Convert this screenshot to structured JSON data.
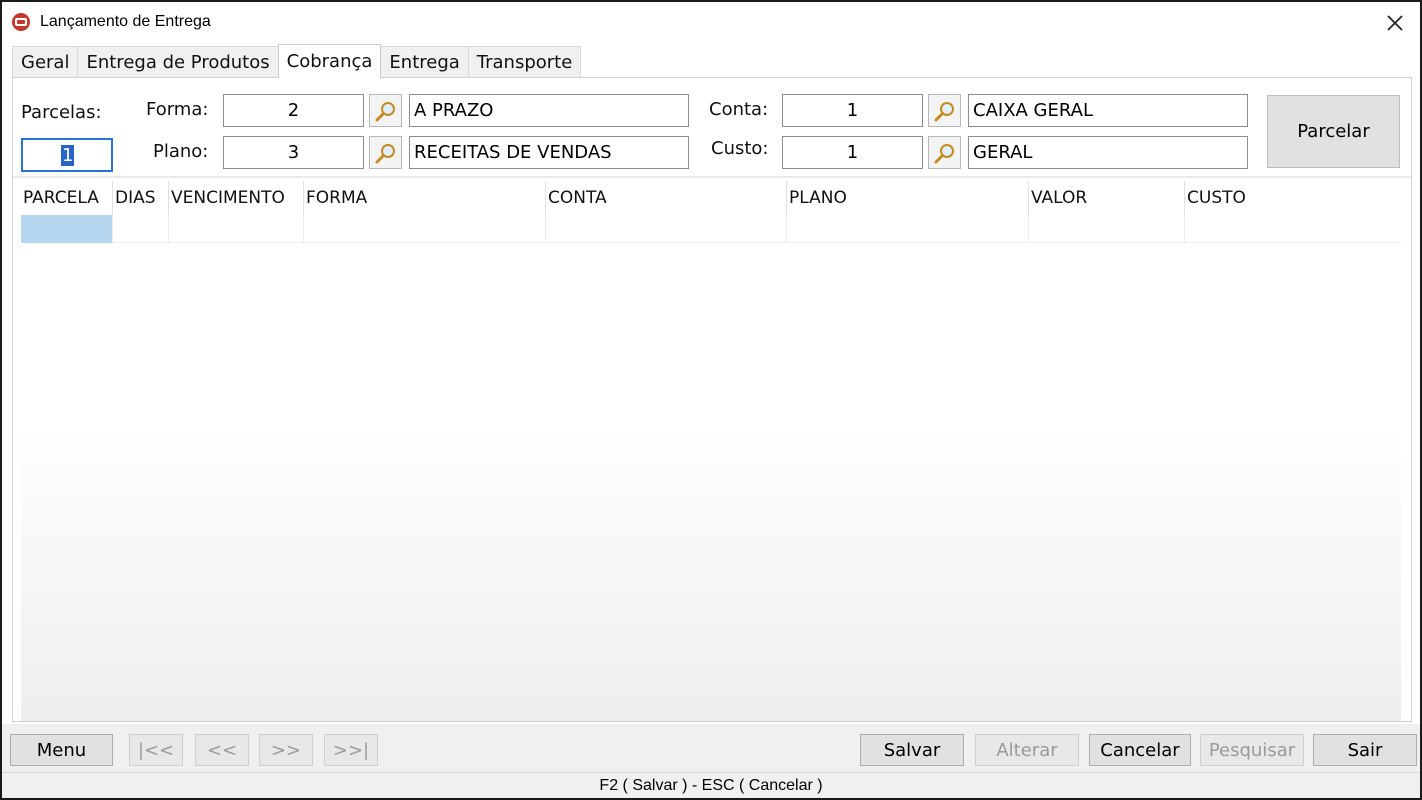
{
  "window": {
    "title": "Lançamento de Entrega",
    "close_glyph": "✕"
  },
  "tabs": [
    {
      "label": "Geral"
    },
    {
      "label": "Entrega de Produtos"
    },
    {
      "label": "Cobrança",
      "active": true
    },
    {
      "label": "Entrega"
    },
    {
      "label": "Transporte"
    }
  ],
  "form": {
    "parcelas_label": "Parcelas:",
    "parcelas_value": "1",
    "forma_label": "Forma:",
    "forma_code": "2",
    "forma_desc": "A PRAZO",
    "plano_label": "Plano:",
    "plano_code": "3",
    "plano_desc": "RECEITAS DE VENDAS",
    "conta_label": "Conta:",
    "conta_code": "1",
    "conta_desc": "CAIXA GERAL",
    "custo_label": "Custo:",
    "custo_code": "1",
    "custo_desc": "GERAL",
    "parcelar_button": "Parcelar"
  },
  "grid": {
    "columns": [
      "PARCELA",
      "DIAS",
      "VENCIMENTO",
      "FORMA",
      "CONTA",
      "PLANO",
      "VALOR",
      "CUSTO"
    ]
  },
  "buttons": {
    "menu": "Menu",
    "first": "|<<",
    "prev": "<<",
    "next": ">>",
    "last": ">>|",
    "salvar": "Salvar",
    "alterar": "Alterar",
    "cancelar": "Cancelar",
    "pesquisar": "Pesquisar",
    "sair": "Sair"
  },
  "status": {
    "text": "F2 ( Salvar )  -  ESC ( Cancelar )"
  },
  "colors": {
    "selection": "#b5d6ee",
    "focus_border": "#2a73d6",
    "app_icon": "#c0392b"
  }
}
